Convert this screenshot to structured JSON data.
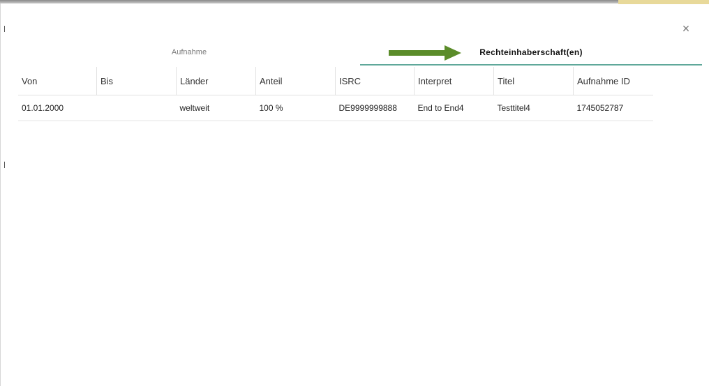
{
  "dialog": {
    "close_icon": "close-icon",
    "close_glyph": "×"
  },
  "tabs": [
    {
      "label": "Aufnahme",
      "active": false
    },
    {
      "label": "Rechteinhaberschaft(en)",
      "active": true
    }
  ],
  "colors": {
    "arrow": "#5b8c2a",
    "active_tab_underline": "#5fa89a"
  },
  "table": {
    "columns": [
      "Von",
      "Bis",
      "Länder",
      "Anteil",
      "ISRC",
      "Interpret",
      "Titel",
      "Aufnahme ID"
    ],
    "rows": [
      [
        "01.01.2000",
        "",
        "weltweit",
        "100 %",
        "DE9999999888",
        "End to End4",
        "Testtitel4",
        "1745052787"
      ]
    ]
  }
}
